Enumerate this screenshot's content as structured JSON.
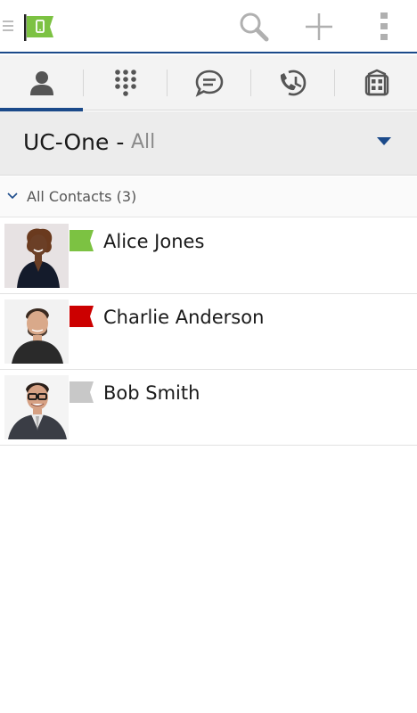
{
  "action_bar": {
    "icons": [
      "menu-icon",
      "app-logo",
      "search-icon",
      "add-icon",
      "overflow-icon"
    ],
    "brand_color": "#1b4a8a",
    "logo_color": "#7cc242"
  },
  "tabs": [
    {
      "name": "contacts",
      "icon": "person-icon",
      "active": true
    },
    {
      "name": "dialpad",
      "icon": "dialpad-icon",
      "active": false
    },
    {
      "name": "chat",
      "icon": "chat-icon",
      "active": false
    },
    {
      "name": "call-history",
      "icon": "call-history-icon",
      "active": false
    },
    {
      "name": "directory",
      "icon": "building-icon",
      "active": false
    }
  ],
  "directory": {
    "title": "UC-One -",
    "filter": "All"
  },
  "group": {
    "label": "All Contacts (3)"
  },
  "contacts": [
    {
      "name": "Alice Jones",
      "presence": "available",
      "presence_color": "#7cc242"
    },
    {
      "name": "Charlie Anderson",
      "presence": "busy",
      "presence_color": "#cc0000"
    },
    {
      "name": "Bob Smith",
      "presence": "offline",
      "presence_color": "#c8c8c8"
    }
  ]
}
